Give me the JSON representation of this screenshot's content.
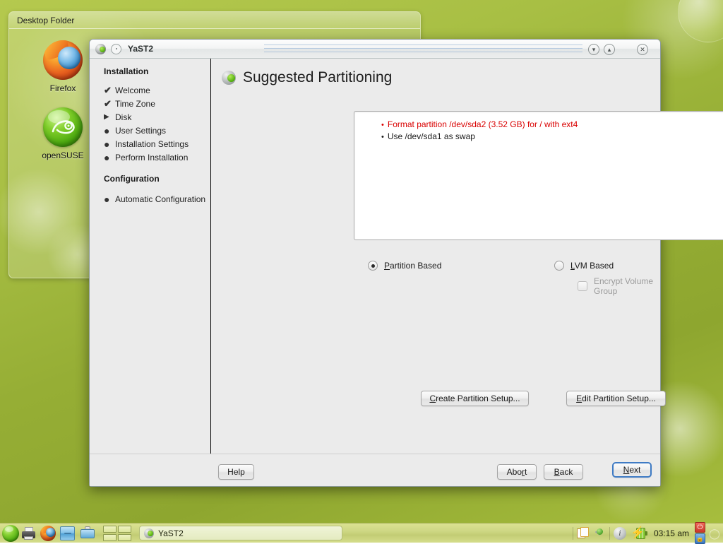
{
  "desktop": {
    "folder_widget": {
      "title": "Desktop Folder",
      "icons": [
        {
          "label": "Firefox",
          "icon": "firefox-icon"
        },
        {
          "label": "openSUSE",
          "icon": "opensuse-icon"
        }
      ]
    }
  },
  "window": {
    "title": "YaST2",
    "icon": "yast-icon",
    "controls": {
      "shade": "shade-icon",
      "minimize": "chevron-down-icon",
      "maximize": "chevron-up-icon",
      "close": "close-icon"
    }
  },
  "sidebar": {
    "heading_installation": "Installation",
    "heading_configuration": "Configuration",
    "installation_steps": [
      {
        "label": "Welcome",
        "marker": "✔",
        "state": "done"
      },
      {
        "label": "Time Zone",
        "marker": "✔",
        "state": "done"
      },
      {
        "label": "Disk",
        "marker": "▶",
        "state": "current"
      },
      {
        "label": "User Settings",
        "marker": "●",
        "state": "pending"
      },
      {
        "label": "Installation Settings",
        "marker": "●",
        "state": "pending"
      },
      {
        "label": "Perform Installation",
        "marker": "●",
        "state": "pending"
      }
    ],
    "configuration_steps": [
      {
        "label": "Automatic Configuration",
        "marker": "●",
        "state": "pending"
      }
    ]
  },
  "main": {
    "page_title": "Suggested Partitioning",
    "partition_list": [
      {
        "bullet": "•",
        "text": "Format partition /dev/sda2 (3.52 GB) for / with ext4",
        "style": "warn"
      },
      {
        "bullet": "•",
        "text": "Use /dev/sda1 as swap",
        "style": "normal"
      }
    ],
    "options": {
      "partition_based": {
        "label_prefix": "",
        "label_accel": "P",
        "label_rest": "artition Based",
        "selected": true
      },
      "lvm_based": {
        "label_prefix": "",
        "label_accel": "L",
        "label_rest": "VM Based",
        "selected": false
      },
      "encrypt_volume_group": {
        "label": "Encrypt Volume Group",
        "checked": false,
        "disabled": true
      }
    },
    "buttons": {
      "create": {
        "accel": "C",
        "rest": "reate Partition Setup..."
      },
      "edit": {
        "accel": "E",
        "rest": "dit Partition Setup..."
      }
    }
  },
  "footer": {
    "help": {
      "label": "Help"
    },
    "abort": {
      "pre": "Abo",
      "accel": "r",
      "post": "t"
    },
    "back": {
      "accel": "B",
      "rest": "ack"
    },
    "next": {
      "accel": "N",
      "rest": "ext",
      "focused": true
    }
  },
  "taskbar": {
    "launchers": [
      {
        "name": "opensuse-menu",
        "icon": "opensuse-menu-icon"
      },
      {
        "name": "printer",
        "icon": "printer-icon"
      },
      {
        "name": "firefox",
        "icon": "firefox-icon"
      },
      {
        "name": "file-manager",
        "icon": "drawer-icon"
      },
      {
        "name": "display-config",
        "icon": "display-icon"
      }
    ],
    "pager_desktops": 4,
    "task": {
      "label": "YaST2",
      "icon": "yast-icon"
    },
    "tray": {
      "clipboard": "clipboard-icon",
      "pin": "pin-icon",
      "info": "i",
      "battery": "battery-charging-icon",
      "clock": "03:15 am",
      "power": "⏻",
      "lock": "🔒"
    }
  },
  "colors": {
    "accent_blue": "#3f7bc4",
    "warn_red": "#d90000",
    "window_bg": "#ebebeb",
    "desktop_green": "#96ae35"
  }
}
